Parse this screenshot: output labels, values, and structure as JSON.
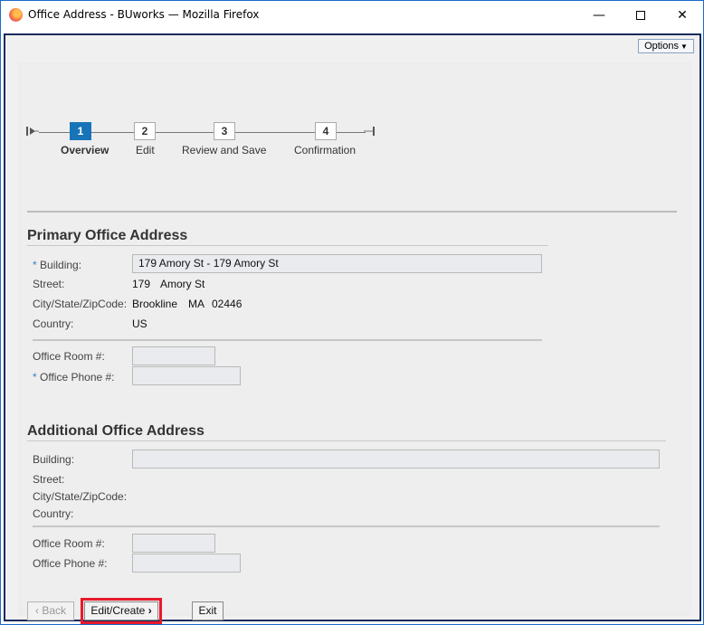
{
  "window": {
    "title": "Office Address - BUworks — Mozilla Firefox",
    "minimize_glyph": "—",
    "close_glyph": "✕"
  },
  "toolbar": {
    "options_label": "Options"
  },
  "stepper": {
    "steps": [
      {
        "number": "1",
        "label": "Overview",
        "active": true
      },
      {
        "number": "2",
        "label": "Edit",
        "active": false
      },
      {
        "number": "3",
        "label": "Review and Save",
        "active": false
      },
      {
        "number": "4",
        "label": "Confirmation",
        "active": false
      }
    ]
  },
  "primary": {
    "title": "Primary Office Address",
    "building_label": "Building:",
    "building_value": "179 Amory St - 179 Amory St",
    "street_label": "Street:",
    "street_number": "179",
    "street_name": "Amory St",
    "city_label": "City/State/ZipCode:",
    "city": "Brookline",
    "state": "MA",
    "zip": "02446",
    "country_label": "Country:",
    "country": "US",
    "room_label": "Office Room #:",
    "room_value": "",
    "phone_label": "Office Phone #:",
    "phone_value": ""
  },
  "additional": {
    "title": "Additional Office Address",
    "building_label": "Building:",
    "building_value": "",
    "street_label": "Street:",
    "city_label": "City/State/ZipCode:",
    "country_label": "Country:",
    "room_label": "Office Room #:",
    "room_value": "",
    "phone_label": "Office Phone #:",
    "phone_value": ""
  },
  "buttons": {
    "back_label": "Back",
    "edit_create_label": "Edit/Create",
    "exit_label": "Exit"
  },
  "required_marker": "*",
  "colors": {
    "accent": "#1774b8",
    "highlight": "#e8182b"
  }
}
